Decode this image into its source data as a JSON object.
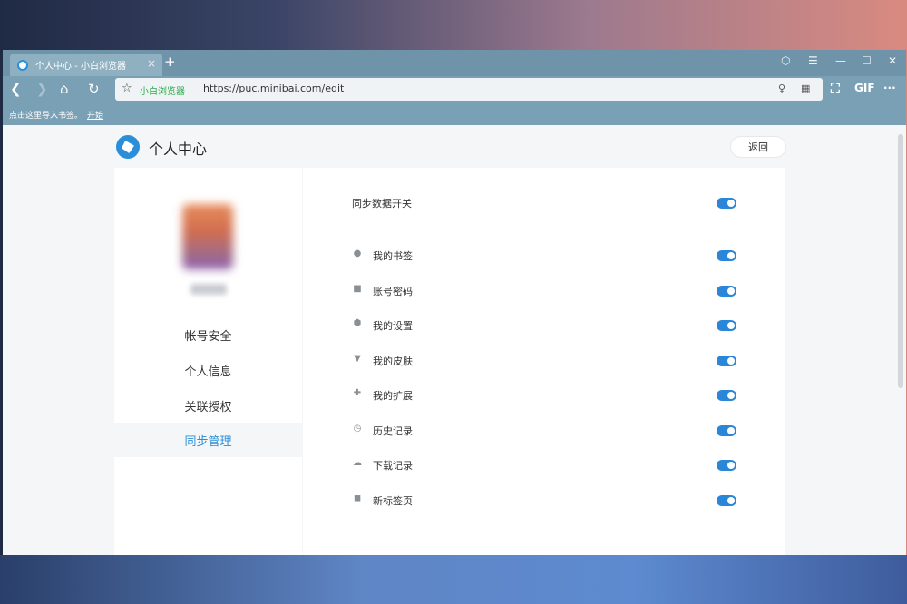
{
  "browser": {
    "tab_title": "个人中心 - 小白浏览器",
    "tab_close": "×",
    "new_tab": "+",
    "address_brand": "小白浏览器",
    "address_url": "https://puc.minibai.com/edit",
    "gif_label": "GIF",
    "more_label": "···"
  },
  "bookmarks_bar": {
    "hint": "点击这里导入书签。",
    "start_link": "开始"
  },
  "page": {
    "title": "个人中心",
    "back_button": "返回"
  },
  "sidebar": {
    "items": [
      {
        "label": "帐号安全",
        "active": false
      },
      {
        "label": "个人信息",
        "active": false
      },
      {
        "label": "关联授权",
        "active": false
      },
      {
        "label": "同步管理",
        "active": true
      }
    ]
  },
  "sync": {
    "master_label": "同步数据开关",
    "master_on": true,
    "items": [
      {
        "label": "我的书签",
        "icon": "user-icon",
        "on": true
      },
      {
        "label": "账号密码",
        "icon": "lock-icon",
        "on": true
      },
      {
        "label": "我的设置",
        "icon": "settings-icon",
        "on": true
      },
      {
        "label": "我的皮肤",
        "icon": "shirt-icon",
        "on": true
      },
      {
        "label": "我的扩展",
        "icon": "puzzle-icon",
        "on": true
      },
      {
        "label": "历史记录",
        "icon": "clock-icon",
        "on": true
      },
      {
        "label": "下载记录",
        "icon": "cloud-download-icon",
        "on": true
      },
      {
        "label": "新标签页",
        "icon": "bookmark-tab-icon",
        "on": true
      }
    ]
  },
  "colors": {
    "accent": "#2a86d8",
    "tab_bar": "#6f93a9",
    "toolbar": "#7aa0b5",
    "address_brand": "#2ea84a"
  }
}
